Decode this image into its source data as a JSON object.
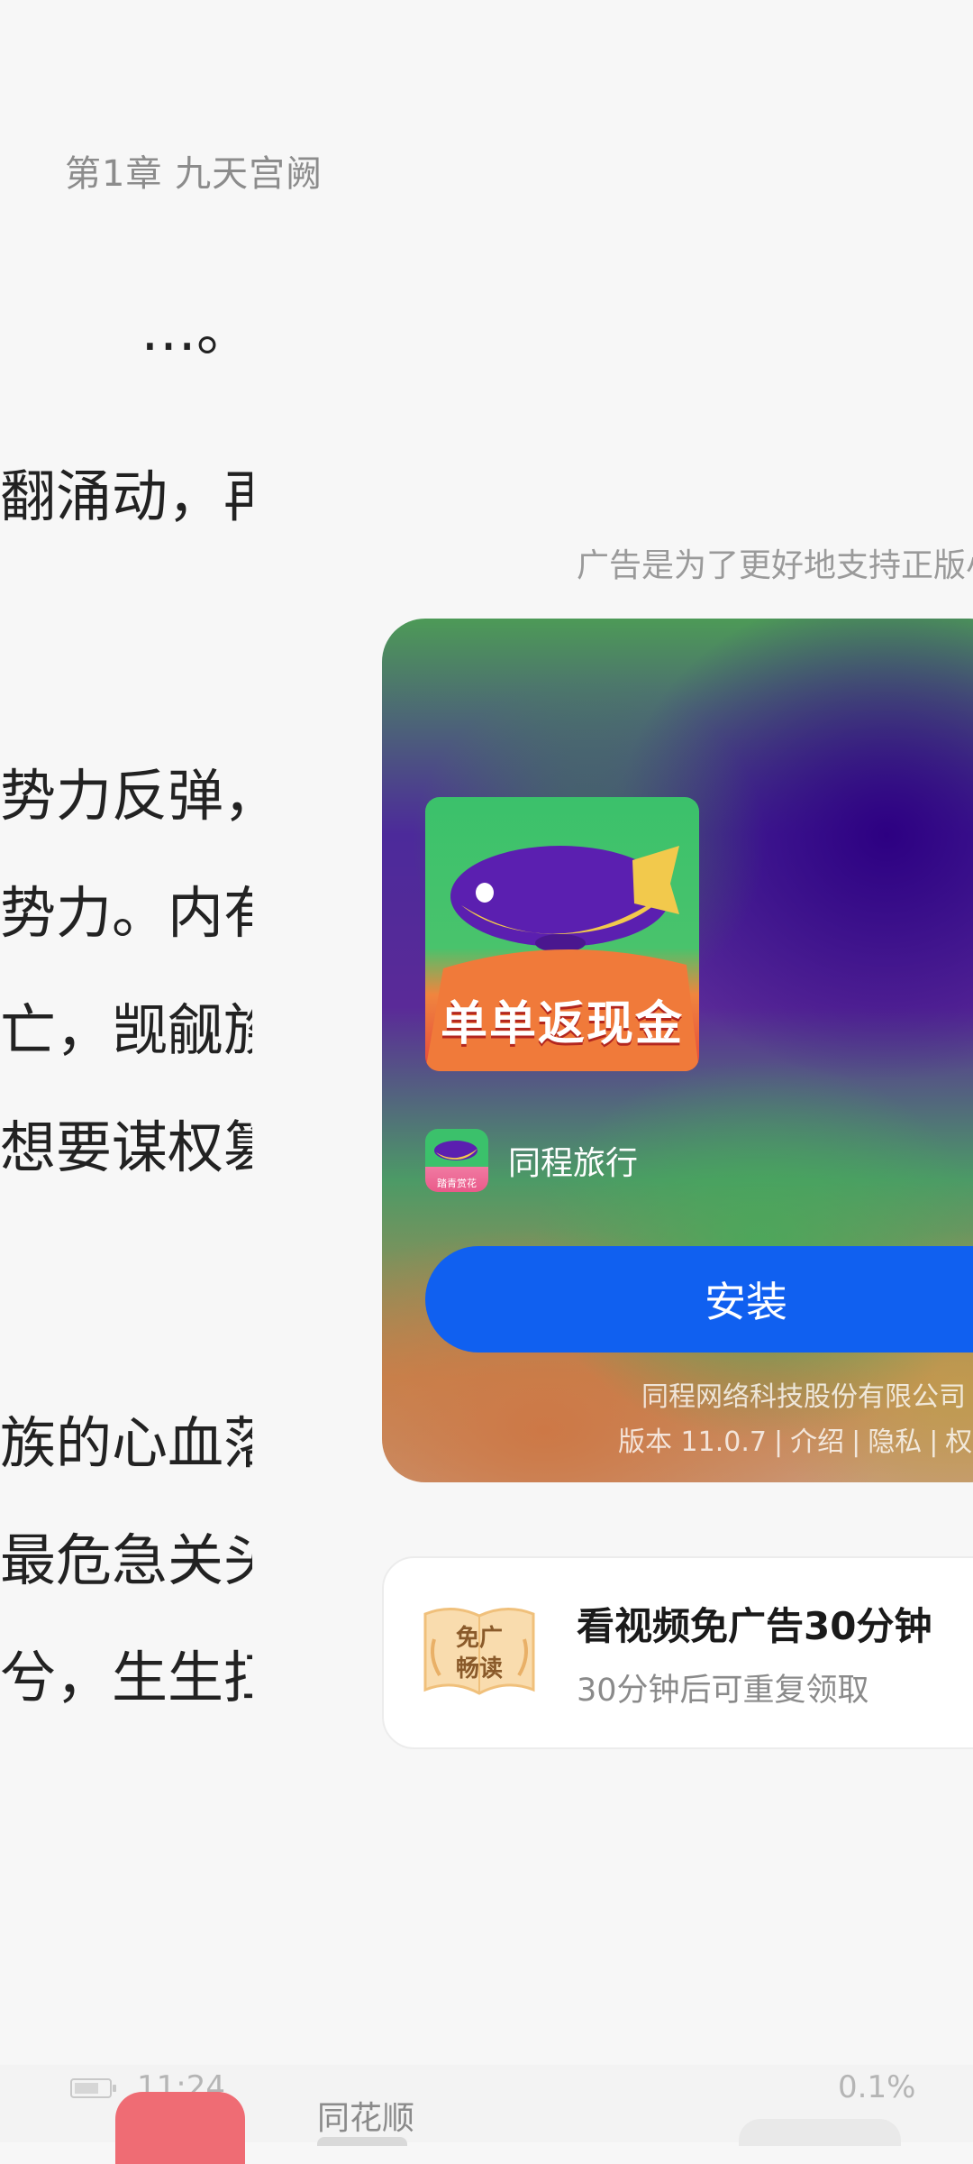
{
  "reader": {
    "chapter_title": "第1章 九天宫阙",
    "lines": [
      "…。",
      "翻涌动，再",
      "势力反弹，",
      "势力。内有",
      "亡，觊觎族",
      "想要谋权篡",
      "族的心血落",
      "最危急关头",
      "兮，生生扛"
    ]
  },
  "ad": {
    "notice": "广告是为了更好地支持正版小",
    "promo_image_text": "单单返现金",
    "app_icon_badge": "踏青赏花",
    "app_name": "同程旅行",
    "install_label": "安装",
    "company": "同程网络科技股份有限公司",
    "version": "版本 11.0.7",
    "links": [
      "介绍",
      "隐私",
      "权限"
    ],
    "install_color": "#1060f0"
  },
  "reward": {
    "badge_line1": "免广",
    "badge_line2": "畅读",
    "title": "看视频免广告30分钟",
    "subtitle": "30分钟后可重复领取"
  },
  "status": {
    "time": "11:24",
    "progress": "0.1%",
    "bottom_app_name": "同花顺"
  }
}
